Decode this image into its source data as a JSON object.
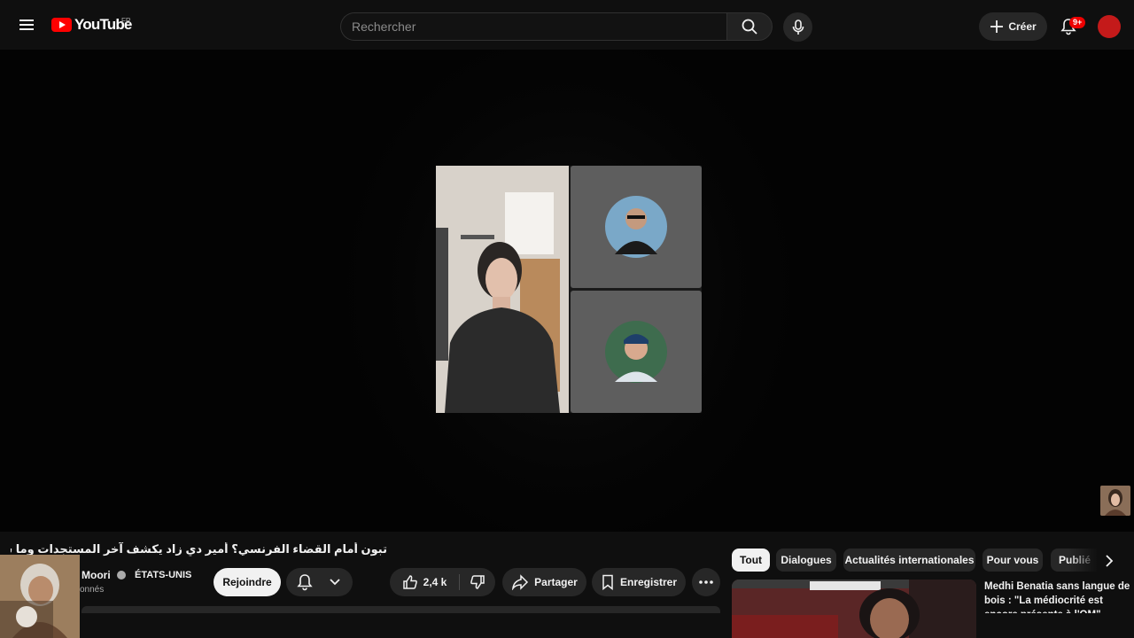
{
  "masthead": {
    "logo_text": "YouTube",
    "country_code": "FR",
    "search_placeholder": "Rechercher",
    "create_label": "Créer",
    "notification_count": "9+"
  },
  "video": {
    "title": "تبون أمام القضاء الفرنسي؟ أمير دي زاد يكشف آخر المستجدات وما سيحدث قريبًا",
    "channel_name": "Moori",
    "channel_country": "ÉTATS-UNIS",
    "subscribers_text": "onnés",
    "join_label": "Rejoindre",
    "like_count": "2,4 k",
    "share_label": "Partager",
    "save_label": "Enregistrer"
  },
  "chips": [
    {
      "label": "Tout",
      "active": true
    },
    {
      "label": "Dialogues",
      "active": false
    },
    {
      "label": "Actualités internationales",
      "active": false
    },
    {
      "label": "Pour vous",
      "active": false
    },
    {
      "label": "Publié",
      "active": false
    }
  ],
  "recommendation": {
    "title": "Medhi Benatia sans langue de bois : \"La médiocrité est encore présente à l'OM\""
  },
  "colors": {
    "background": "#0f0f0f",
    "brand_red": "#ff0000",
    "pill_bg": "#272727",
    "tile_gray": "#5e5e5e"
  }
}
